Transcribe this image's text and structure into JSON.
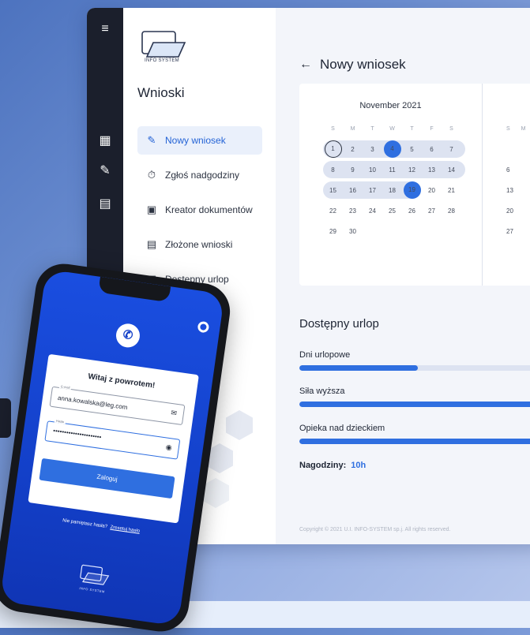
{
  "desktop": {
    "logo_text": "INFO SYSTEM",
    "sidebar_title": "Wnioski",
    "nav": [
      {
        "label": "Nowy wniosek",
        "icon": "pencil-icon",
        "active": true
      },
      {
        "label": "Zgłoś nadgodziny",
        "icon": "stopwatch-icon"
      },
      {
        "label": "Kreator dokumentów",
        "icon": "document-scan-icon"
      },
      {
        "label": "Złożone wnioski",
        "icon": "document-search-icon"
      },
      {
        "label": "Dostępny urlop",
        "icon": "calendar-add-icon"
      }
    ],
    "page_title": "Nowy wniosek",
    "calendar": {
      "month": "November 2021",
      "dow": [
        "S",
        "M",
        "T",
        "W",
        "T",
        "F",
        "S"
      ],
      "weeks": [
        [
          "1",
          "2",
          "3",
          "4",
          "5",
          "6",
          "7"
        ],
        [
          "8",
          "9",
          "10",
          "11",
          "12",
          "13",
          "14"
        ],
        [
          "15",
          "16",
          "17",
          "18",
          "19",
          "20",
          "21"
        ],
        [
          "22",
          "23",
          "24",
          "25",
          "26",
          "27",
          "28"
        ],
        [
          "29",
          "30",
          "",
          "",
          "",
          "",
          ""
        ]
      ],
      "next_dow": [
        "S",
        "M"
      ],
      "next_days": [
        "6",
        "13",
        "20",
        "27"
      ]
    },
    "leave_title": "Dostępny urlop",
    "leave": [
      {
        "label": "Dni urlopowe",
        "fill": 0.47
      },
      {
        "label": "Siła wyższa",
        "fill": 1.0
      },
      {
        "label": "Opieka nad dzieckiem",
        "fill": 1.0
      }
    ],
    "overtime_label": "Nagodziny:",
    "overtime_value": "10h",
    "copyright": "Copyright © 2021 U.I. INFO-SYSTEM sp.j. All rights reserved."
  },
  "mobile": {
    "welcome": "Witaj z powrotem!",
    "email_label": "E-mail",
    "email_value": "anna.kowalska@leg.com",
    "password_label": "Hasło",
    "password_value": "••••••••••••••••••••••",
    "login_button": "Zaloguj",
    "forgot_text": "Nie pamiętasz hasła?",
    "reset_link": "Zresetuj hasło",
    "logo_text": "INFO SYSTEM"
  }
}
